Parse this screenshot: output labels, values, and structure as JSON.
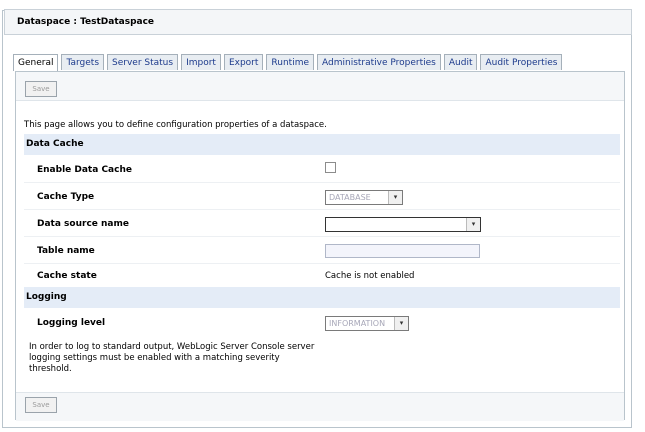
{
  "title": "Dataspace : TestDataspace",
  "tabs": [
    {
      "label": "General",
      "active": true
    },
    {
      "label": "Targets"
    },
    {
      "label": "Server Status"
    },
    {
      "label": "Import"
    },
    {
      "label": "Export"
    },
    {
      "label": "Runtime"
    },
    {
      "label": "Administrative Properties"
    },
    {
      "label": "Audit"
    },
    {
      "label": "Audit Properties"
    }
  ],
  "buttons": {
    "save_top": "Save",
    "save_bottom": "Save"
  },
  "intro": "This page allows you to define configuration properties of a dataspace.",
  "data_cache": {
    "heading": "Data Cache",
    "enable_label": "Enable Data Cache",
    "enable_checked": false,
    "cache_type_label": "Cache Type",
    "cache_type_value": "DATABASE",
    "data_source_label": "Data source name",
    "data_source_value": "",
    "table_name_label": "Table name",
    "table_name_value": "",
    "cache_state_label": "Cache state",
    "cache_state_value": "Cache is not enabled"
  },
  "logging": {
    "heading": "Logging",
    "level_label": "Logging level",
    "level_value": "INFORMATION",
    "note": "In order to log to standard output, WebLogic Server Console server logging settings must be enabled with a matching severity threshold."
  },
  "icons": {
    "dropdown": "chevron-down-icon"
  }
}
